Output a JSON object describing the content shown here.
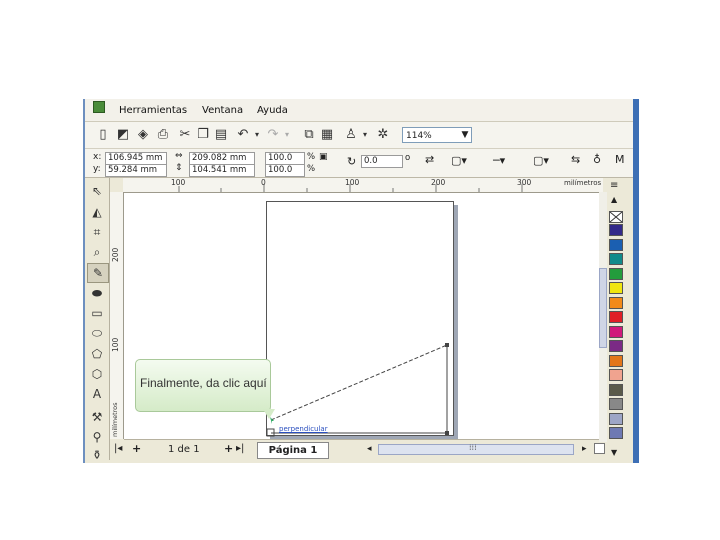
{
  "menu": {
    "items": [
      "Herramientas",
      "Ventana",
      "Ayuda"
    ]
  },
  "toolbar": {
    "zoom_value": "114%"
  },
  "properties": {
    "x_label": "x:",
    "x_value": "106.945 mm",
    "y_label": "y:",
    "y_value": "59.284 mm",
    "width_value": "209.082 mm",
    "height_value": "104.541 mm",
    "scale_x": "100.0",
    "scale_y": "100.0",
    "percent_symbol": "%",
    "angle_value": "0.0",
    "degree_symbol": "o"
  },
  "ruler": {
    "top_labels": [
      "100",
      "0",
      "100",
      "200",
      "300"
    ],
    "units_label": "milímetros",
    "left_labels": [
      "200",
      "100"
    ],
    "left_units_label": "milímetros"
  },
  "page_nav": {
    "counter": "1 de 1",
    "page_tab": "Página 1"
  },
  "canvas": {
    "snap_label": "perpendicular"
  },
  "callout": {
    "text": "Finalmente, da clic aquí"
  },
  "palette": {
    "colors": [
      "#ffffff",
      "#332a8a",
      "#1b5fb1",
      "#108a8a",
      "#239c3c",
      "#f0e60f",
      "#f28a1a",
      "#e01f26",
      "#d0197b",
      "#7b2a85",
      "#e3761a",
      "#f0a38f",
      "#5a5a4a",
      "#888888",
      "#9da5c6",
      "#6e79b3"
    ]
  }
}
